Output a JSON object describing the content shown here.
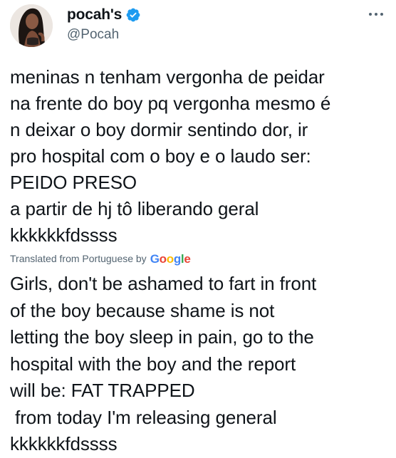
{
  "author": {
    "display_name": "pocah's",
    "handle": "@Pocah",
    "verified": true,
    "verified_color": "#1d9bf0",
    "avatar_icon": "profile-photo"
  },
  "menu": {
    "icon": "more-horizontal-icon"
  },
  "tweet": {
    "lines": [
      "meninas n tenham vergonha de peidar",
      "na frente do boy pq vergonha mesmo é",
      "n deixar o boy dormir sentindo dor, ir",
      "pro hospital com o boy e o laudo ser:",
      "PEIDO PRESO",
      "a partir de hj tô liberando geral",
      "kkkkkkfdssss"
    ]
  },
  "translation": {
    "label": "Translated from Portuguese by",
    "provider": "Google",
    "provider_letters": [
      "G",
      "o",
      "o",
      "g",
      "l",
      "e"
    ],
    "lines": [
      "Girls, don't be ashamed to fart in front",
      "of the boy because shame is not",
      "letting the boy sleep in pain, go to the",
      "hospital with the boy and the report",
      "will be: FAT TRAPPED",
      " from today I'm releasing general",
      "kkkkkkfdssss"
    ]
  },
  "colors": {
    "text_primary": "#0f1419",
    "text_secondary": "#536471",
    "google_blue": "#4285f4",
    "google_red": "#ea4335",
    "google_yellow": "#fbbc05",
    "google_green": "#34a853"
  }
}
